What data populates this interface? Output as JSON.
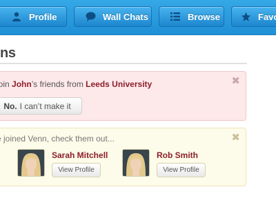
{
  "nav": {
    "items": [
      {
        "label": "Profile",
        "icon": "user-icon"
      },
      {
        "label": "Wall Chats",
        "icon": "speech-bubble-icon"
      },
      {
        "label": "Browse",
        "icon": "list-icon"
      },
      {
        "label": "Favo",
        "icon": "star-icon"
      }
    ]
  },
  "page": {
    "title": "ns"
  },
  "invite": {
    "prefix": "join ",
    "name": "John",
    "middle": "’s friends from ",
    "school": "Leeds University",
    "decline_strong": "No.",
    "decline_rest": "I can’t make it",
    "close": "✖"
  },
  "joined": {
    "message": "e joined Venn, check them out...",
    "close": "✖",
    "people": [
      {
        "name": "Sarah Mitchell",
        "button": "View Profile"
      },
      {
        "name": "Rob Smith",
        "button": "View Profile"
      }
    ]
  },
  "colors": {
    "accent": "#2196dc",
    "link_red": "#8b1f2a",
    "invite_bg": "#fde8ea",
    "joined_bg": "#fdfbe9"
  }
}
